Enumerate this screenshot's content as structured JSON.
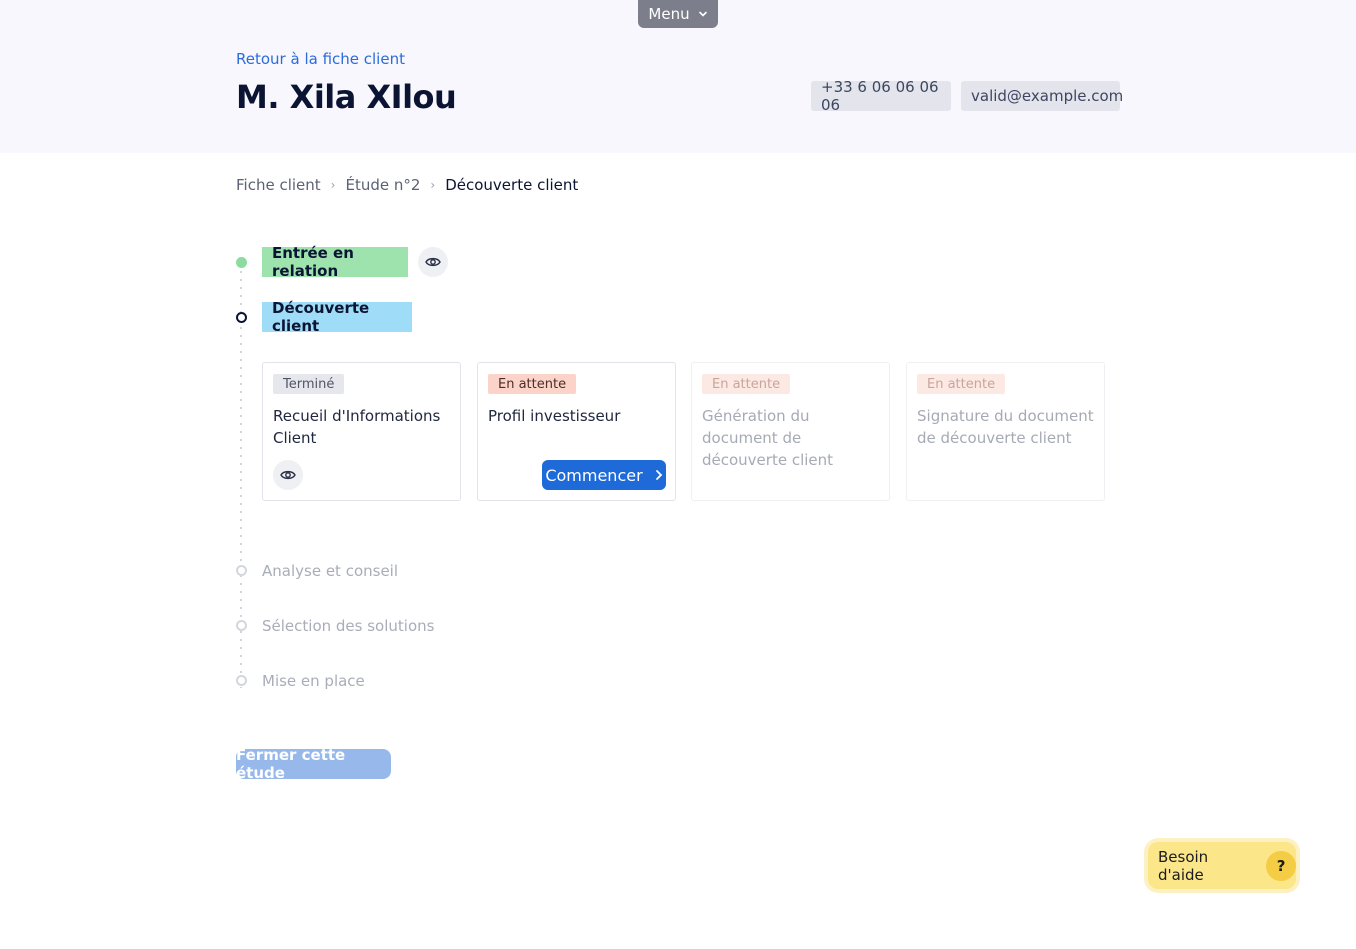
{
  "header": {
    "menu_label": "Menu",
    "back_link": "Retour à la fiche client",
    "client_name": "M. Xila XIlou",
    "phone": "+33 6 06 06 06 06",
    "email": "valid@example.com"
  },
  "breadcrumb": {
    "items": [
      "Fiche client",
      "Étude n°2",
      "Découverte client"
    ]
  },
  "steps": {
    "done": "Entrée en relation",
    "current": "Découverte client",
    "future": [
      "Analyse et conseil",
      "Sélection des solutions",
      "Mise en place"
    ]
  },
  "cards": [
    {
      "badge": "Terminé",
      "title": "Recueil d'Informations Client"
    },
    {
      "badge": "En attente",
      "title": "Profil investisseur",
      "action": "Commencer"
    },
    {
      "badge": "En attente",
      "title": "Génération du document de découverte client"
    },
    {
      "badge": "En attente",
      "title": "Signature du document de découverte client"
    }
  ],
  "footer": {
    "close_study": "Fermer cette étude",
    "help": "Besoin d'aide",
    "help_icon": "?"
  },
  "colors": {
    "accent": "#1e6ad9",
    "done": "#9ee3ae",
    "current": "#9fdcf7",
    "waiting_badge": "#fcd3c8",
    "help": "#fce68a"
  },
  "icons": {
    "menu": "chevron-down-icon",
    "view": "eye-icon",
    "start": "chevron-right-icon",
    "help": "question-icon"
  }
}
